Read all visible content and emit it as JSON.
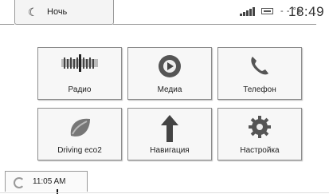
{
  "header": {
    "mode_label": "Ночь",
    "temperature": "- - °c",
    "time": "18:49"
  },
  "tiles": [
    {
      "label": "Радио"
    },
    {
      "label": "Медиа"
    },
    {
      "label": "Телефон"
    },
    {
      "label": "Driving eco2"
    },
    {
      "label": "Навигация"
    },
    {
      "label": "Настройка"
    }
  ],
  "footer": {
    "clock_label": "11:05 AM"
  },
  "colors": {
    "border": "#8c8c8c",
    "tile_bg": "#f7f7f7",
    "text": "#222222"
  }
}
